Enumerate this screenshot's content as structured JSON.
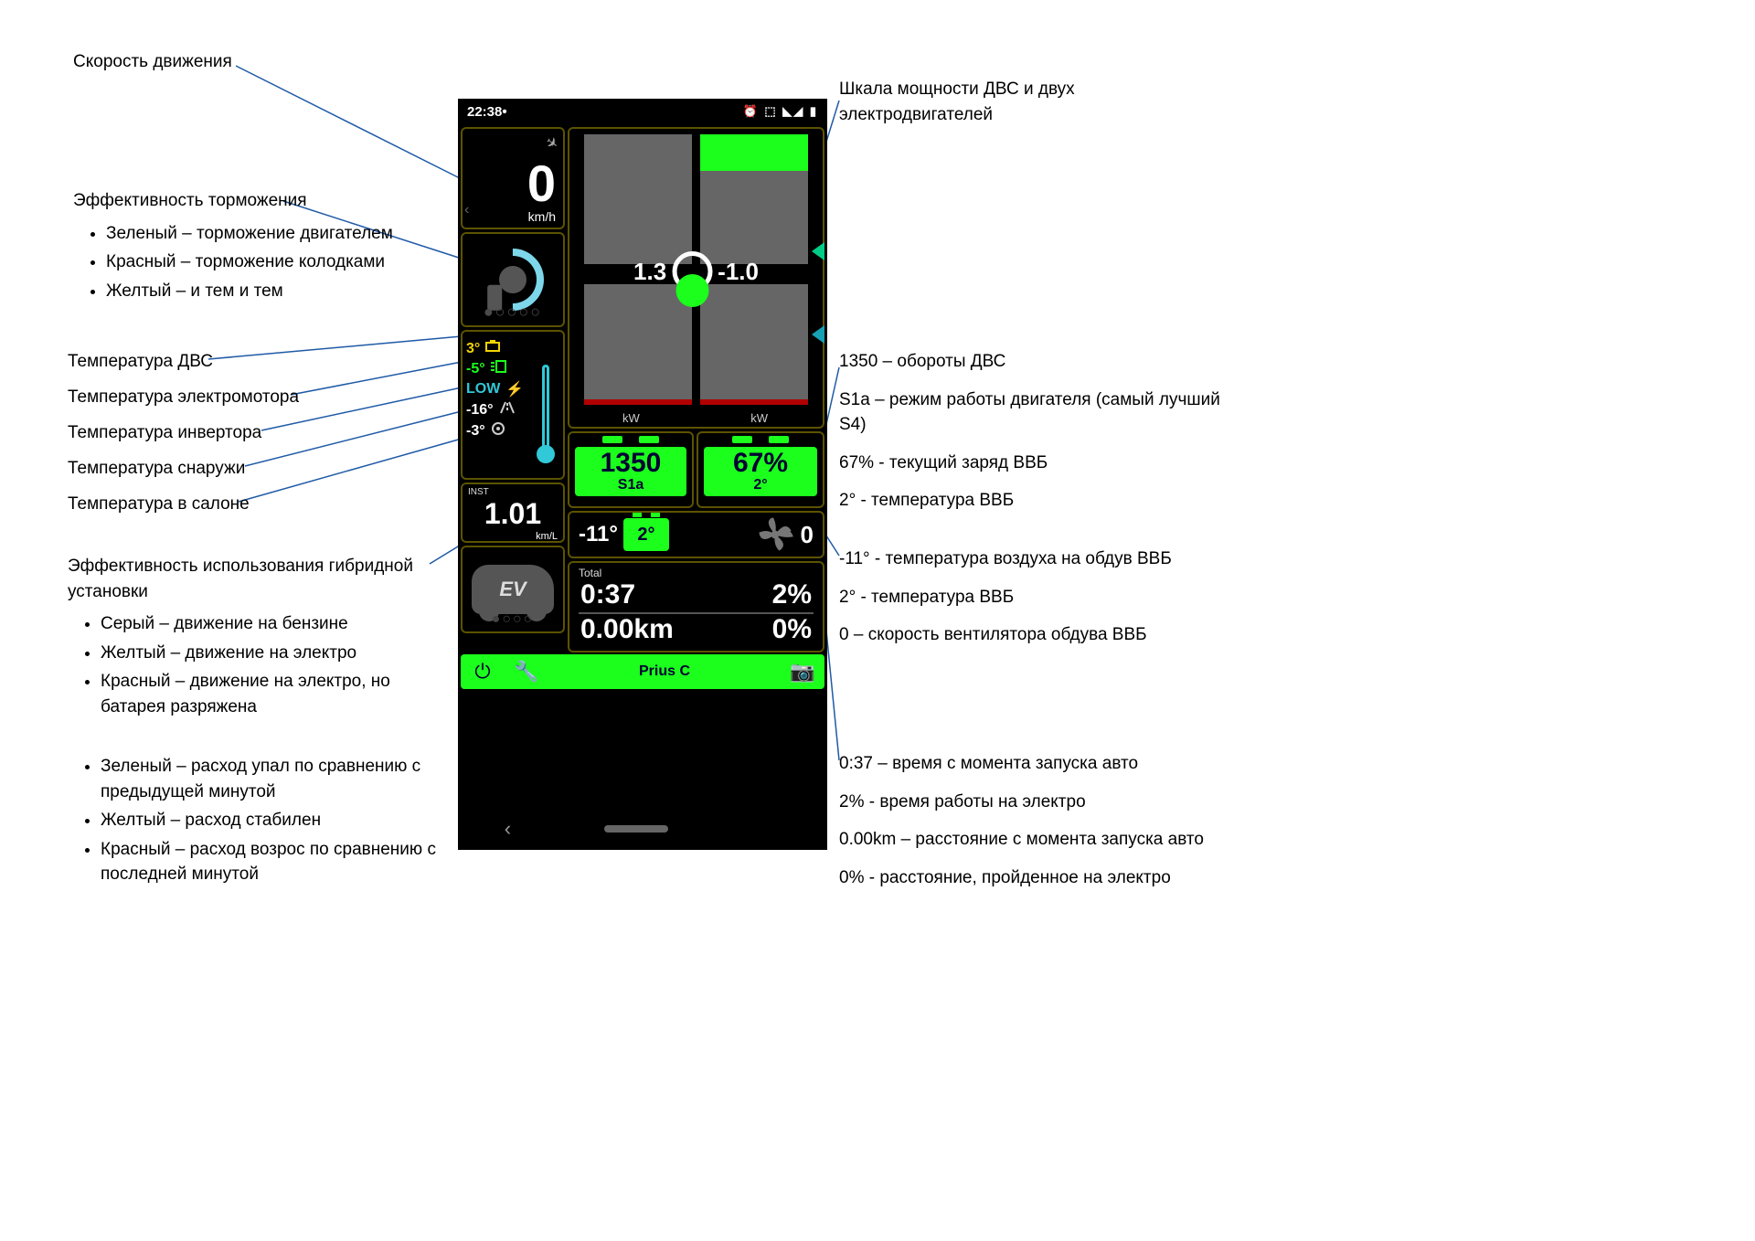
{
  "statusbar": {
    "time": "22:38",
    "icons": "⏰ ⬚ ◣◢ ▮"
  },
  "speed": {
    "value": "0",
    "unit": "km/h"
  },
  "temps": {
    "engine": "3°",
    "motor": "-5°",
    "inverter": "LOW",
    "outside": "-16°",
    "cabin": "-3°"
  },
  "power": {
    "left_val": "1.3",
    "right_val": "-1.0",
    "unit": "kW"
  },
  "rpm": {
    "value": "1350",
    "mode": "S1a"
  },
  "soc": {
    "percent": "67%",
    "temp": "2°"
  },
  "inst": {
    "label": "INST",
    "value": "1.01",
    "unit": "km/L"
  },
  "fan": {
    "air_temp": "-11°",
    "batt_temp": "2°",
    "speed": "0"
  },
  "ev": {
    "label": "EV"
  },
  "total": {
    "label": "Total",
    "time": "0:37",
    "time_pct": "2%",
    "dist": "0.00km",
    "dist_pct": "0%"
  },
  "bottombar": {
    "car": "Prius C"
  },
  "callouts": {
    "speed": "Скорость движения",
    "brake_title": "Эффективность торможения",
    "brake_items": [
      "Зеленый – торможение двигателем",
      "Красный – торможение колодками",
      "Желтый – и тем и тем"
    ],
    "t_engine": "Температура ДВС",
    "t_motor": "Температура электромотора",
    "t_inverter": "Температура инвертора",
    "t_outside": "Температура снаружи",
    "t_cabin": "Температура в салоне",
    "hybrid_title": "Эффективность использования гибридной установки",
    "hybrid_items1": [
      "Серый – движение на бензине",
      "Желтый – движение на электро",
      "Красный – движение на электро, но батарея разряжена"
    ],
    "hybrid_items2": [
      "Зеленый – расход упал по сравнению с предыдущей минутой",
      "Желтый – расход стабилен",
      "Красный – расход возрос по сравнению с последней минутой"
    ],
    "power_title": "Шкала мощности ДВС и двух электродвигателей",
    "right_block1": [
      "1350 – обороты ДВС",
      "S1a – режим работы двигателя (самый лучший S4)",
      "67% - текущий заряд ВВБ",
      "2° - температура ВВБ"
    ],
    "right_block2": [
      "-11° - температура воздуха на обдув ВВБ",
      "2° - температура ВВБ",
      "0 – скорость вентилятора обдува ВВБ"
    ],
    "right_block3": [
      "0:37 – время с момента запуска авто",
      "2% - время работы на электро",
      "0.00km – расстояние с момента запуска авто",
      "0% - расстояние, пройденное на электро"
    ]
  }
}
